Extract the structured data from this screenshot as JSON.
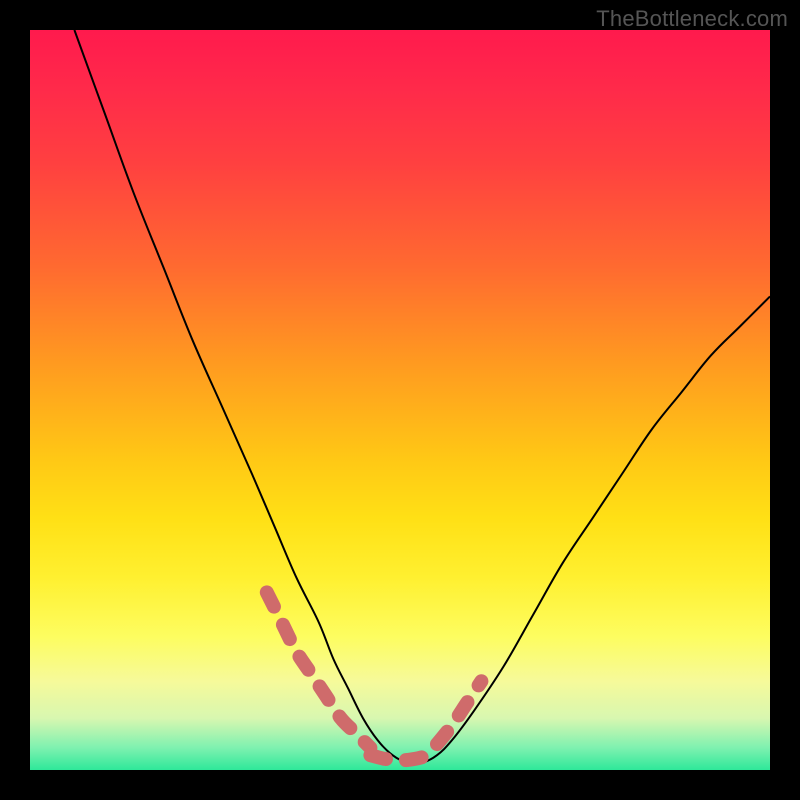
{
  "watermark": "TheBottleneck.com",
  "chart_data": {
    "type": "line",
    "title": "",
    "xlabel": "",
    "ylabel": "",
    "xlim": [
      0,
      100
    ],
    "ylim": [
      0,
      100
    ],
    "note": "Axes unlabeled; values are fractional positions (0–100) estimated from pixel geometry. y represents vertical height of the curve above the bottom of the plot; x is horizontal position across the plot.",
    "series": [
      {
        "name": "main-curve",
        "x": [
          6,
          10,
          14,
          18,
          22,
          26,
          30,
          33,
          36,
          39,
          41,
          43,
          45,
          47,
          49,
          51,
          53,
          55,
          57,
          60,
          64,
          68,
          72,
          76,
          80,
          84,
          88,
          92,
          96,
          100
        ],
        "y": [
          100,
          89,
          78,
          68,
          58,
          49,
          40,
          33,
          26,
          20,
          15,
          11,
          7,
          4,
          2,
          1,
          1,
          2,
          4,
          8,
          14,
          21,
          28,
          34,
          40,
          46,
          51,
          56,
          60,
          64
        ]
      },
      {
        "name": "highlight-dashes-left",
        "x": [
          32,
          34,
          36,
          38,
          40,
          42,
          44,
          46
        ],
        "y": [
          24,
          20,
          16,
          13,
          10,
          7,
          5,
          3
        ]
      },
      {
        "name": "highlight-dashes-bottom",
        "x": [
          46,
          48,
          50,
          52,
          54
        ],
        "y": [
          2,
          1.5,
          1.3,
          1.5,
          2
        ]
      },
      {
        "name": "highlight-dashes-right",
        "x": [
          55,
          57,
          59,
          61
        ],
        "y": [
          3.5,
          6,
          9,
          12
        ]
      }
    ],
    "colors": {
      "curve": "#000000",
      "highlight": "#cf6b6b",
      "gradient_top": "#ff1a4d",
      "gradient_mid": "#ffe015",
      "gradient_bottom": "#2ee89a"
    }
  }
}
